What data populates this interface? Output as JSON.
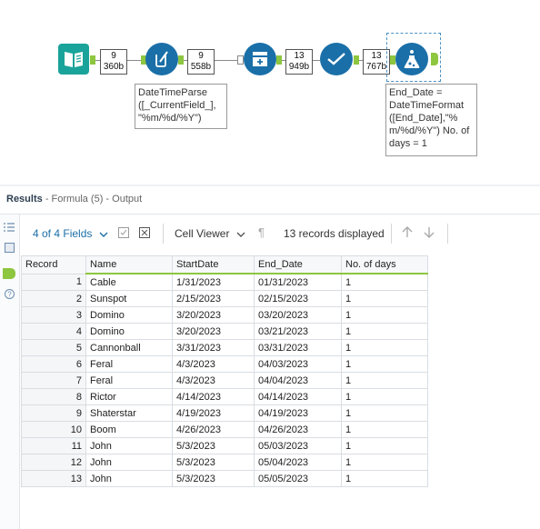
{
  "canvas": {
    "connections": [
      {
        "records": "9",
        "size": "360b"
      },
      {
        "records": "9",
        "size": "558b"
      },
      {
        "records": "13",
        "size": "949b"
      },
      {
        "records": "13",
        "size": "767b"
      }
    ],
    "annotation_multifield": "DateTimeParse ([_CurrentField_], \"%m/%d/%Y\")",
    "annotation_formula": "End_Date = DateTimeFormat ([End_Date],\"% m/%d/%Y\") No. of days = 1",
    "colors": {
      "accent": "#1a6fa8",
      "input": "#1aa39a",
      "anchor": "#8dc63f"
    }
  },
  "results": {
    "title": "Results",
    "subtitle": "- Formula (5) - Output"
  },
  "toolbar": {
    "fields_label": "4 of 4 Fields",
    "cell_viewer_label": "Cell Viewer",
    "records_label": "13 records displayed"
  },
  "table": {
    "headers": [
      "Record",
      "Name",
      "StartDate",
      "End_Date",
      "No. of days"
    ],
    "rows": [
      [
        "1",
        "Cable",
        "1/31/2023",
        "01/31/2023",
        "1"
      ],
      [
        "2",
        "Sunspot",
        "2/15/2023",
        "02/15/2023",
        "1"
      ],
      [
        "3",
        "Domino",
        "3/20/2023",
        "03/20/2023",
        "1"
      ],
      [
        "4",
        "Domino",
        "3/20/2023",
        "03/21/2023",
        "1"
      ],
      [
        "5",
        "Cannonball",
        "3/31/2023",
        "03/31/2023",
        "1"
      ],
      [
        "6",
        "Feral",
        "4/3/2023",
        "04/03/2023",
        "1"
      ],
      [
        "7",
        "Feral",
        "4/3/2023",
        "04/04/2023",
        "1"
      ],
      [
        "8",
        "Rictor",
        "4/14/2023",
        "04/14/2023",
        "1"
      ],
      [
        "9",
        "Shaterstar",
        "4/19/2023",
        "04/19/2023",
        "1"
      ],
      [
        "10",
        "Boom",
        "4/26/2023",
        "04/26/2023",
        "1"
      ],
      [
        "11",
        "John",
        "5/3/2023",
        "05/03/2023",
        "1"
      ],
      [
        "12",
        "John",
        "5/3/2023",
        "05/04/2023",
        "1"
      ],
      [
        "13",
        "John",
        "5/3/2023",
        "05/05/2023",
        "1"
      ]
    ]
  }
}
